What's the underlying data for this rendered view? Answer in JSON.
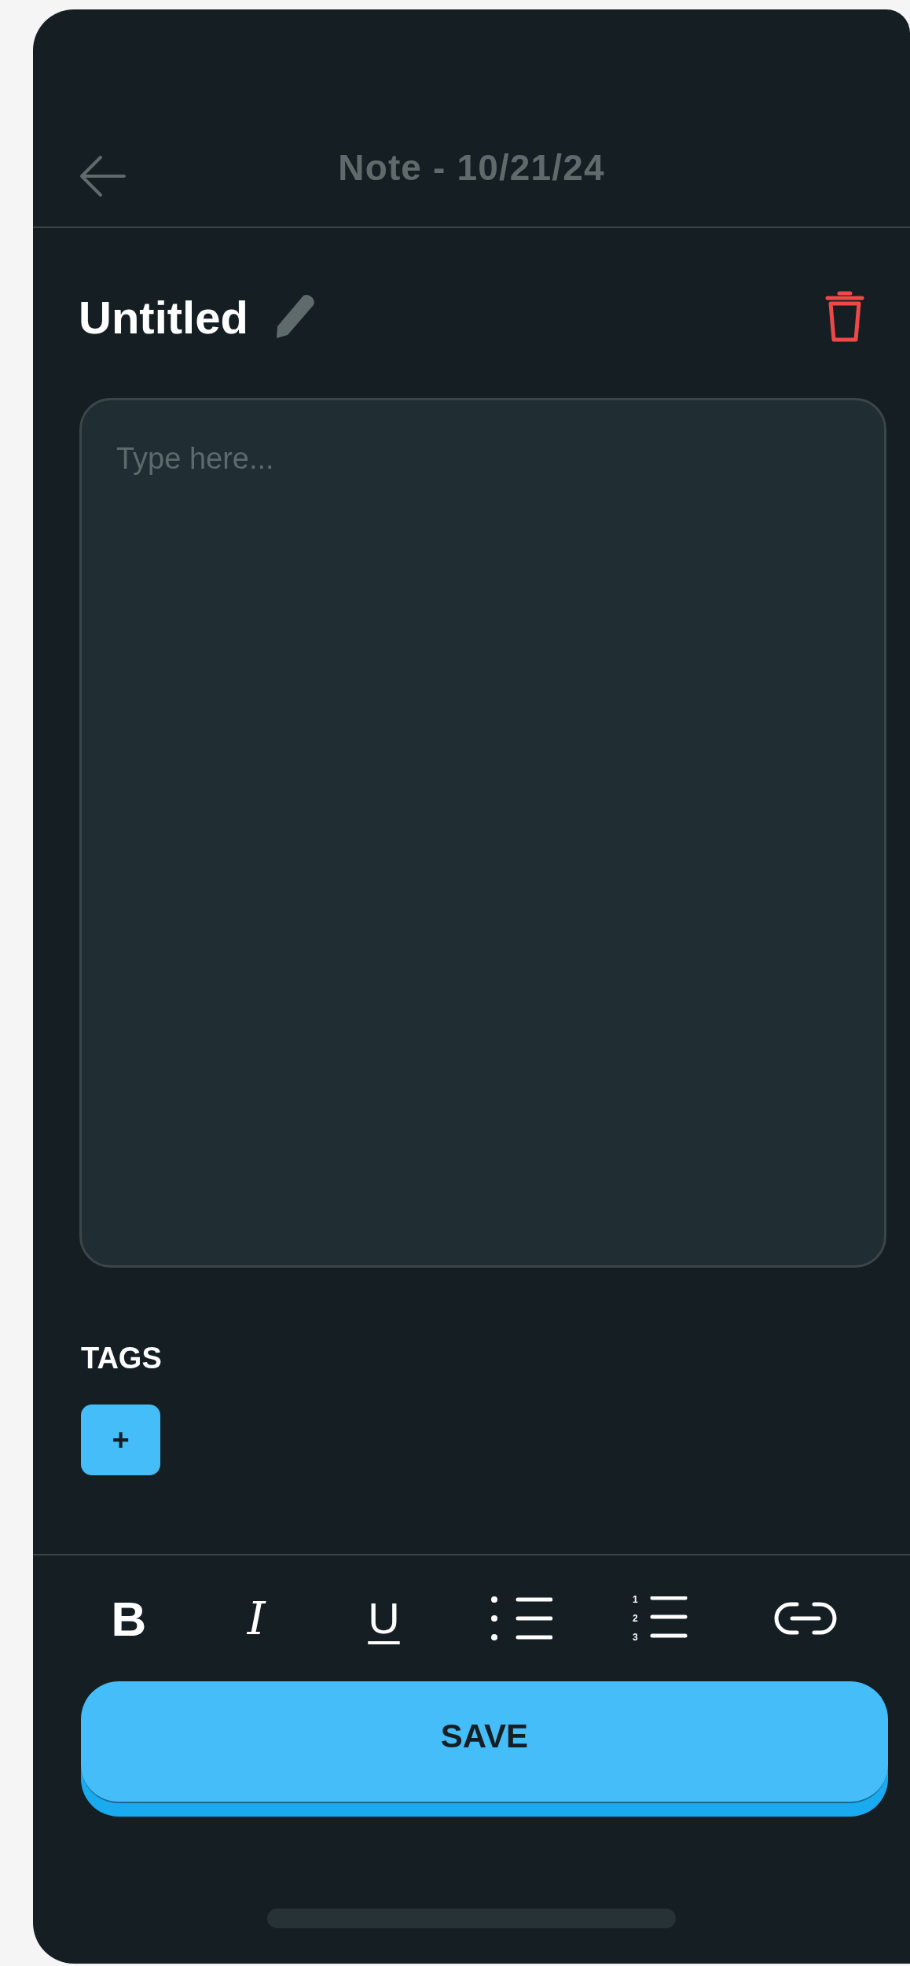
{
  "header": {
    "title": "Note - 10/21/24"
  },
  "note": {
    "title": "Untitled",
    "placeholder": "Type here..."
  },
  "tags": {
    "label": "TAGS",
    "add_button": "+"
  },
  "toolbar": [
    {
      "kind": "bold",
      "glyph": "B"
    },
    {
      "kind": "italic",
      "glyph": "I"
    },
    {
      "kind": "underline",
      "glyph": "U"
    },
    {
      "kind": "bullets"
    },
    {
      "kind": "numbered",
      "numbers": [
        "1",
        "2",
        "3"
      ]
    },
    {
      "kind": "link"
    }
  ],
  "save_button": "SAVE"
}
